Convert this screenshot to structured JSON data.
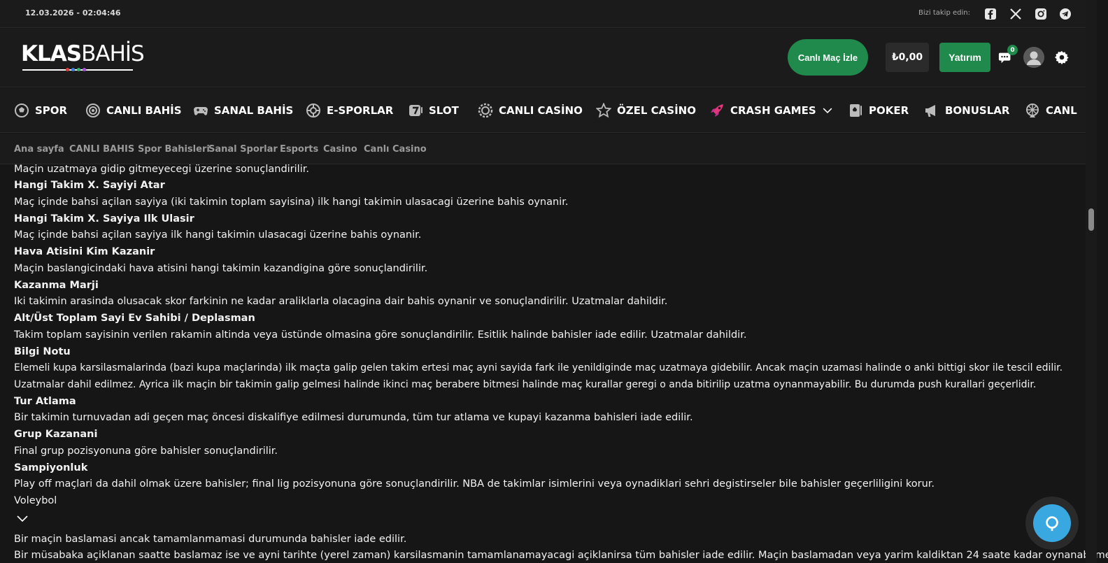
{
  "topbar": {
    "datetime": "12.03.2026 - 02:04:46",
    "follow_label": "Bizi takip edin:",
    "social": [
      "facebook-icon",
      "x-icon",
      "instagram-icon",
      "telegram-icon"
    ]
  },
  "header": {
    "logo_bold": "KLAS",
    "logo_light": "BAHİS",
    "live_button": "Canlı Maç İzle",
    "balance": "₺0,00",
    "deposit_button": "Yatırım",
    "chat_badge": "0"
  },
  "nav": [
    {
      "label": "SPOR",
      "icon": "soccer-ball-icon"
    },
    {
      "label": "CANLI BAHİS",
      "icon": "live-signal-icon"
    },
    {
      "label": "SANAL BAHİS",
      "icon": "gamepad-icon"
    },
    {
      "label": "E-SPORLAR",
      "icon": "esports-icon"
    },
    {
      "label": "SLOT",
      "icon": "slot-seven-icon"
    },
    {
      "label": "CANLI CASİNO",
      "icon": "casino-chip-icon"
    },
    {
      "label": "ÖZEL CASİNO",
      "icon": "star-icon"
    },
    {
      "label": "CRASH GAMES",
      "icon": "rocket-icon"
    },
    {
      "label": "POKER",
      "icon": "playing-card-icon"
    },
    {
      "label": "BONUSLAR",
      "icon": "megaphone-icon"
    },
    {
      "label": "CANL",
      "icon": "wheel-icon"
    }
  ],
  "subnav": [
    "Ana sayfa",
    "CANLI BAHIS",
    "Spor Bahisleri",
    "Sanal Sporlar",
    "Esports",
    "Casino",
    "Canlı Casino"
  ],
  "content": {
    "lines": [
      {
        "text": "Maçin uzatmaya gidip gitmeyecegi üzerine sonuçlandirilir.",
        "heading": false
      },
      {
        "text": "Hangi Takim X. Sayiyi Atar",
        "heading": true
      },
      {
        "text": "Maç içinde bahsi açilan sayiya (iki takimin toplam sayisina) ilk hangi takimin ulasacagi üzerine bahis oynanir.",
        "heading": false
      },
      {
        "text": "Hangi Takim X. Sayiya Ilk Ulasir",
        "heading": true
      },
      {
        "text": "Maç içinde bahsi açilan sayiya ilk hangi takimin ulasacagi üzerine bahis oynanir.",
        "heading": false
      },
      {
        "text": "Hava Atisini Kim Kazanir",
        "heading": true
      },
      {
        "text": "Maçin baslangicindaki hava atisini hangi takimin kazandigina göre sonuçlandirilir.",
        "heading": false
      },
      {
        "text": "Kazanma Marji",
        "heading": true
      },
      {
        "text": "Iki takimin arasinda olusacak skor farkinin ne kadar araliklarla olacagina dair bahis oynanir ve sonuçlandirilir. Uzatmalar dahildir.",
        "heading": false
      },
      {
        "text": "Alt/Üst Toplam Sayi Ev Sahibi / Deplasman",
        "heading": true
      },
      {
        "text": "Takim toplam sayisinin verilen rakamin altinda veya üstünde olmasina göre sonuçlandirilir. Esitlik halinde bahisler iade edilir. Uzatmalar dahildir.",
        "heading": false
      },
      {
        "text": "Bilgi Notu",
        "heading": true
      },
      {
        "text": "Elemeli kupa karsilasmalarinda (bazi kupa maçlarinda) ilk maçta galip gelen takim ertesi maç ayni sayida fark ile yenildiginde maç uzatmaya gidebilir. Ancak maçin uzamasi halinde o anki bittigi skor ile tescil edilir.",
        "heading": false
      },
      {
        "text": "Uzatmalar dahil edilmez. Ayrica ilk maçin bir takimin galip gelmesi halinde ikinci maç berabere bitmesi halinde maç kurallar geregi o anda bitirilip uzatma oynanmayabilir. Bu durumda push kurallari geçerlidir.",
        "heading": false
      },
      {
        "text": "Tur Atlama",
        "heading": true
      },
      {
        "text": "Bir takimin turnuvadan adi geçen maç öncesi diskalifiye edilmesi durumunda, tüm tur atlama ve kupayi kazanma bahisleri iade edilir.",
        "heading": false
      },
      {
        "text": "Grup Kazanani",
        "heading": true
      },
      {
        "text": "Final grup pozisyonuna göre bahisler sonuçlandirilir.",
        "heading": false
      },
      {
        "text": "Sampiyonluk",
        "heading": true
      },
      {
        "text": "Play off maçlari da dahil olmak üzere bahisler; final lig pozisyonuna göre sonuçlandirilir. NBA de takimlar isimlerini veya oynadiklari sehri degistirseler bile bahisler geçerliligini korur.",
        "heading": false
      }
    ],
    "section_title": "Voleybol",
    "after_lines": [
      "Bir maçin baslamasi ancak tamamlanmamasi durumunda bahisler iade edilir.",
      "Bir müsabaka açiklanan saatte baslamaz ise ve ayni tarihte (yerel zaman) karsilasmanin tamamlanamayacagi açiklanirsa tüm bahisler iade edilir. Maçin baslamadan veya yarim kaldiktan 24 saate kadar oynanabilmesi"
    ]
  },
  "colors": {
    "background": "#161616",
    "panel": "#1b1b1b",
    "accent_green": "#1f8a4c",
    "chat_blue": "#3aa8e0"
  }
}
